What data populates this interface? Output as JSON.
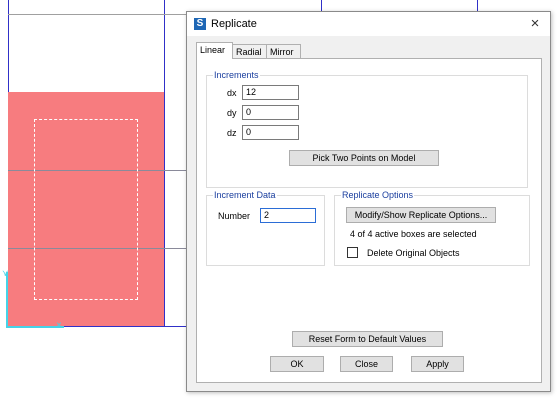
{
  "dialog": {
    "app_icon_letter": "S",
    "title": "Replicate",
    "close_glyph": "×"
  },
  "tabs": [
    {
      "label": "Linear",
      "active": true
    },
    {
      "label": "Radial",
      "active": false
    },
    {
      "label": "Mirror",
      "active": false
    }
  ],
  "increments": {
    "title": "Increments",
    "dx_label": "dx",
    "dx_value": "12",
    "dy_label": "dy",
    "dy_value": "0",
    "dz_label": "dz",
    "dz_value": "0",
    "pick_button": "Pick Two Points on Model"
  },
  "increment_data": {
    "title": "Increment Data",
    "number_label": "Number",
    "number_value": "2"
  },
  "replicate_options": {
    "title": "Replicate Options",
    "modify_button": "Modify/Show Replicate Options...",
    "status_text": "4 of 4 active boxes are selected",
    "delete_label": "Delete Original Objects",
    "delete_checked": false
  },
  "footer": {
    "reset_button": "Reset Form to Default Values",
    "ok_button": "OK",
    "close_button": "Close",
    "apply_button": "Apply"
  },
  "colors": {
    "selected_object_fill": "#f77c7f",
    "grid_line": "#3030c8",
    "axis": "#45d3e8",
    "group_title": "#1a3e9e"
  }
}
